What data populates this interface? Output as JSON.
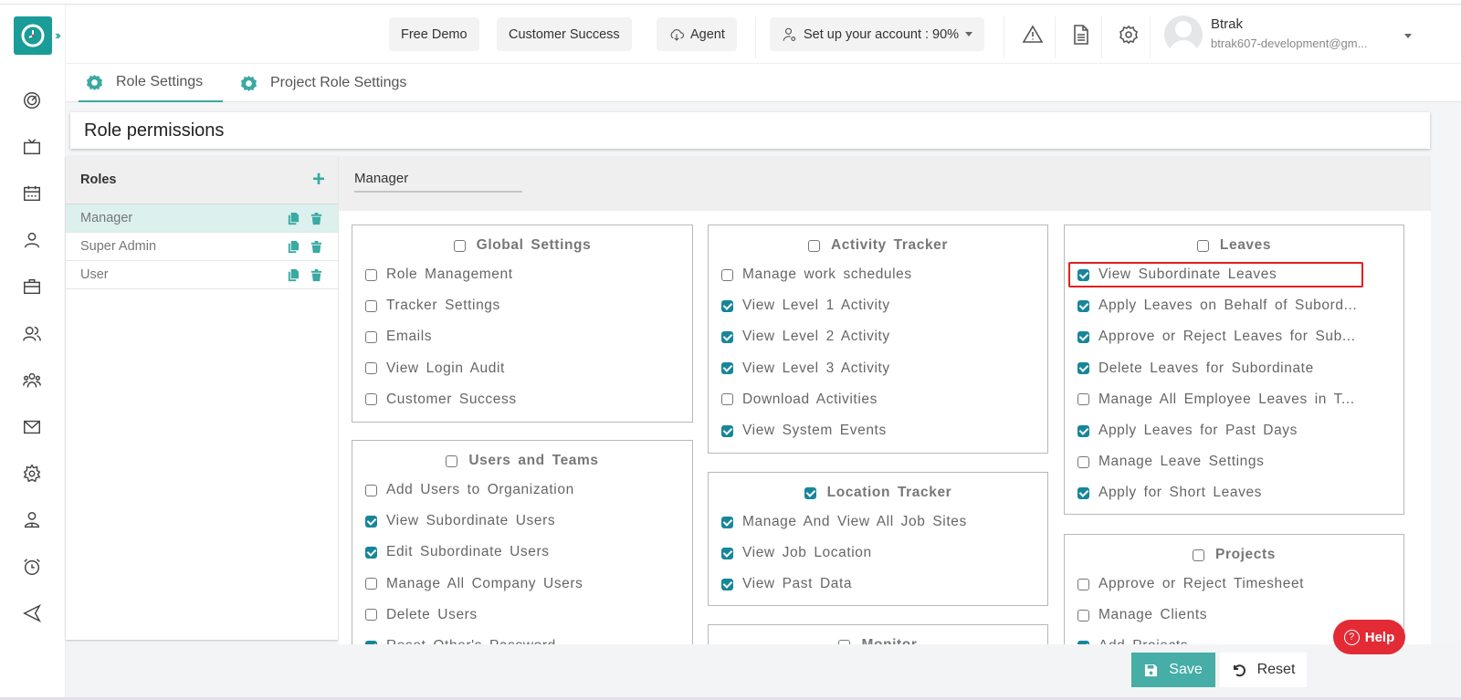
{
  "header": {
    "buttons": {
      "free_demo": "Free Demo",
      "customer_success": "Customer Success",
      "agent": "Agent",
      "setup": "Set up your account : 90%"
    },
    "setup_progress_percent": 90,
    "user": {
      "name": "Btrak",
      "email": "btrak607-development@gm..."
    }
  },
  "tabs": [
    {
      "label": "Role Settings",
      "active": true
    },
    {
      "label": "Project Role Settings",
      "active": false
    }
  ],
  "page_title": "Role permissions",
  "roles_panel": {
    "title": "Roles",
    "add_icon": "+",
    "roles": [
      {
        "name": "Manager",
        "selected": true
      },
      {
        "name": "Super Admin",
        "selected": false
      },
      {
        "name": "User",
        "selected": false
      }
    ]
  },
  "selected_role": "Manager",
  "permission_groups": {
    "global_settings": {
      "title": "Global Settings",
      "checked": false,
      "items": [
        {
          "label": "Role Management",
          "checked": false
        },
        {
          "label": "Tracker Settings",
          "checked": false
        },
        {
          "label": "Emails",
          "checked": false
        },
        {
          "label": "View Login Audit",
          "checked": false
        },
        {
          "label": "Customer Success",
          "checked": false
        }
      ]
    },
    "users_and_teams": {
      "title": "Users and Teams",
      "checked": false,
      "items": [
        {
          "label": "Add Users to Organization",
          "checked": false
        },
        {
          "label": "View Subordinate Users",
          "checked": true
        },
        {
          "label": "Edit Subordinate Users",
          "checked": true
        },
        {
          "label": "Manage All Company Users",
          "checked": false
        },
        {
          "label": "Delete Users",
          "checked": false
        },
        {
          "label": "Reset Other's Password",
          "checked": true
        }
      ]
    },
    "activity_tracker": {
      "title": "Activity Tracker",
      "checked": false,
      "items": [
        {
          "label": "Manage work schedules",
          "checked": false
        },
        {
          "label": "View Level 1 Activity",
          "checked": true
        },
        {
          "label": "View Level 2 Activity",
          "checked": true
        },
        {
          "label": "View Level 3 Activity",
          "checked": true
        },
        {
          "label": "Download Activities",
          "checked": false
        },
        {
          "label": "View System Events",
          "checked": true
        }
      ]
    },
    "location_tracker": {
      "title": "Location Tracker",
      "checked": true,
      "items": [
        {
          "label": "Manage And View All Job Sites",
          "checked": true
        },
        {
          "label": "View Job Location",
          "checked": true
        },
        {
          "label": "View Past Data",
          "checked": true
        }
      ]
    },
    "monitor": {
      "title": "Monitor",
      "checked": false,
      "items": []
    },
    "leaves": {
      "title": "Leaves",
      "checked": false,
      "items": [
        {
          "label": "View Subordinate Leaves",
          "checked": true
        },
        {
          "label": "Apply Leaves on Behalf of Subord...",
          "checked": true
        },
        {
          "label": "Approve or Reject Leaves for Sub...",
          "checked": true
        },
        {
          "label": "Delete Leaves for Subordinate",
          "checked": true
        },
        {
          "label": "Manage All Employee Leaves in T...",
          "checked": false
        },
        {
          "label": "Apply Leaves for Past Days",
          "checked": true
        },
        {
          "label": "Manage Leave Settings",
          "checked": false
        },
        {
          "label": "Apply for Short Leaves",
          "checked": true
        }
      ]
    },
    "projects": {
      "title": "Projects",
      "checked": false,
      "items": [
        {
          "label": "Approve or Reject Timesheet",
          "checked": false
        },
        {
          "label": "Manage Clients",
          "checked": false
        },
        {
          "label": "Add Projects",
          "checked": true
        }
      ]
    }
  },
  "footer": {
    "save_label": "Save",
    "reset_label": "Reset"
  },
  "help_label": "Help",
  "colors": {
    "brand": "#1a9c98",
    "accent": "#3aa9a3",
    "checkbox_checked": "#17869a",
    "help": "#e32b35",
    "highlight": "#e02020"
  }
}
